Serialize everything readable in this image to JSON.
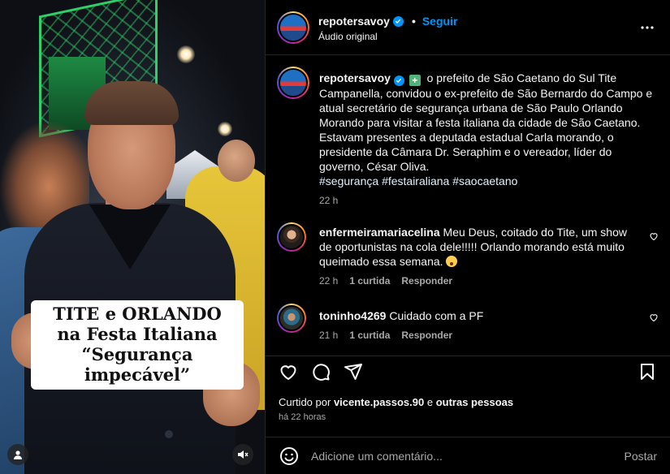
{
  "video": {
    "sticker_lines": [
      "TITE e ORLANDO",
      "na Festa Italiana",
      "“Segurança impecável”"
    ],
    "icons": {
      "user": "user-icon",
      "mute": "speaker-muted-icon"
    }
  },
  "header": {
    "username": "repotersavoy",
    "follow_label": "Seguir",
    "subtitle": "Áudio original",
    "separator": "•"
  },
  "caption": {
    "username": "repotersavoy",
    "text": "o prefeito de São Caetano do Sul Tite Campanella, convidou o ex-prefeito de São Bernardo do Campo e atual secretário de segurança urbana de São Paulo Orlando Morando para visitar a festa italiana da cidade de São Caetano. Estavam presentes a deputada estadual Carla morando, o presidente da Câmara Dr. Seraphim e o vereador, líder do governo, César Oliva.",
    "hashtags": [
      "#segurança",
      "#festairaliana",
      "#saocaetano"
    ],
    "time": "22 h"
  },
  "comments": [
    {
      "username": "enfermeiramariacelina",
      "text": "Meu Deus, coitado do Tite, um show de oportunistas na cola dele!!!!! Orlando morando está muito queimado essa semana.",
      "time": "22 h",
      "likes": "1 curtida",
      "reply_label": "Responder"
    },
    {
      "username": "toninho4269",
      "text": "Cuidado com a PF",
      "time": "21 h",
      "likes": "1 curtida",
      "reply_label": "Responder"
    }
  ],
  "actions": {
    "liked_by_prefix": "Curtido por",
    "liked_by_user": "vicente.passos.90",
    "liked_by_and": "e",
    "liked_by_others": "outras pessoas",
    "time_ago": "há 22 horas"
  },
  "add_comment": {
    "placeholder": "Adicione um comentário...",
    "post_label": "Postar"
  },
  "colors": {
    "background": "#000000",
    "accent": "#0095f6",
    "muted_text": "#a8a8a8",
    "hashtag": "#e0f1ff"
  }
}
